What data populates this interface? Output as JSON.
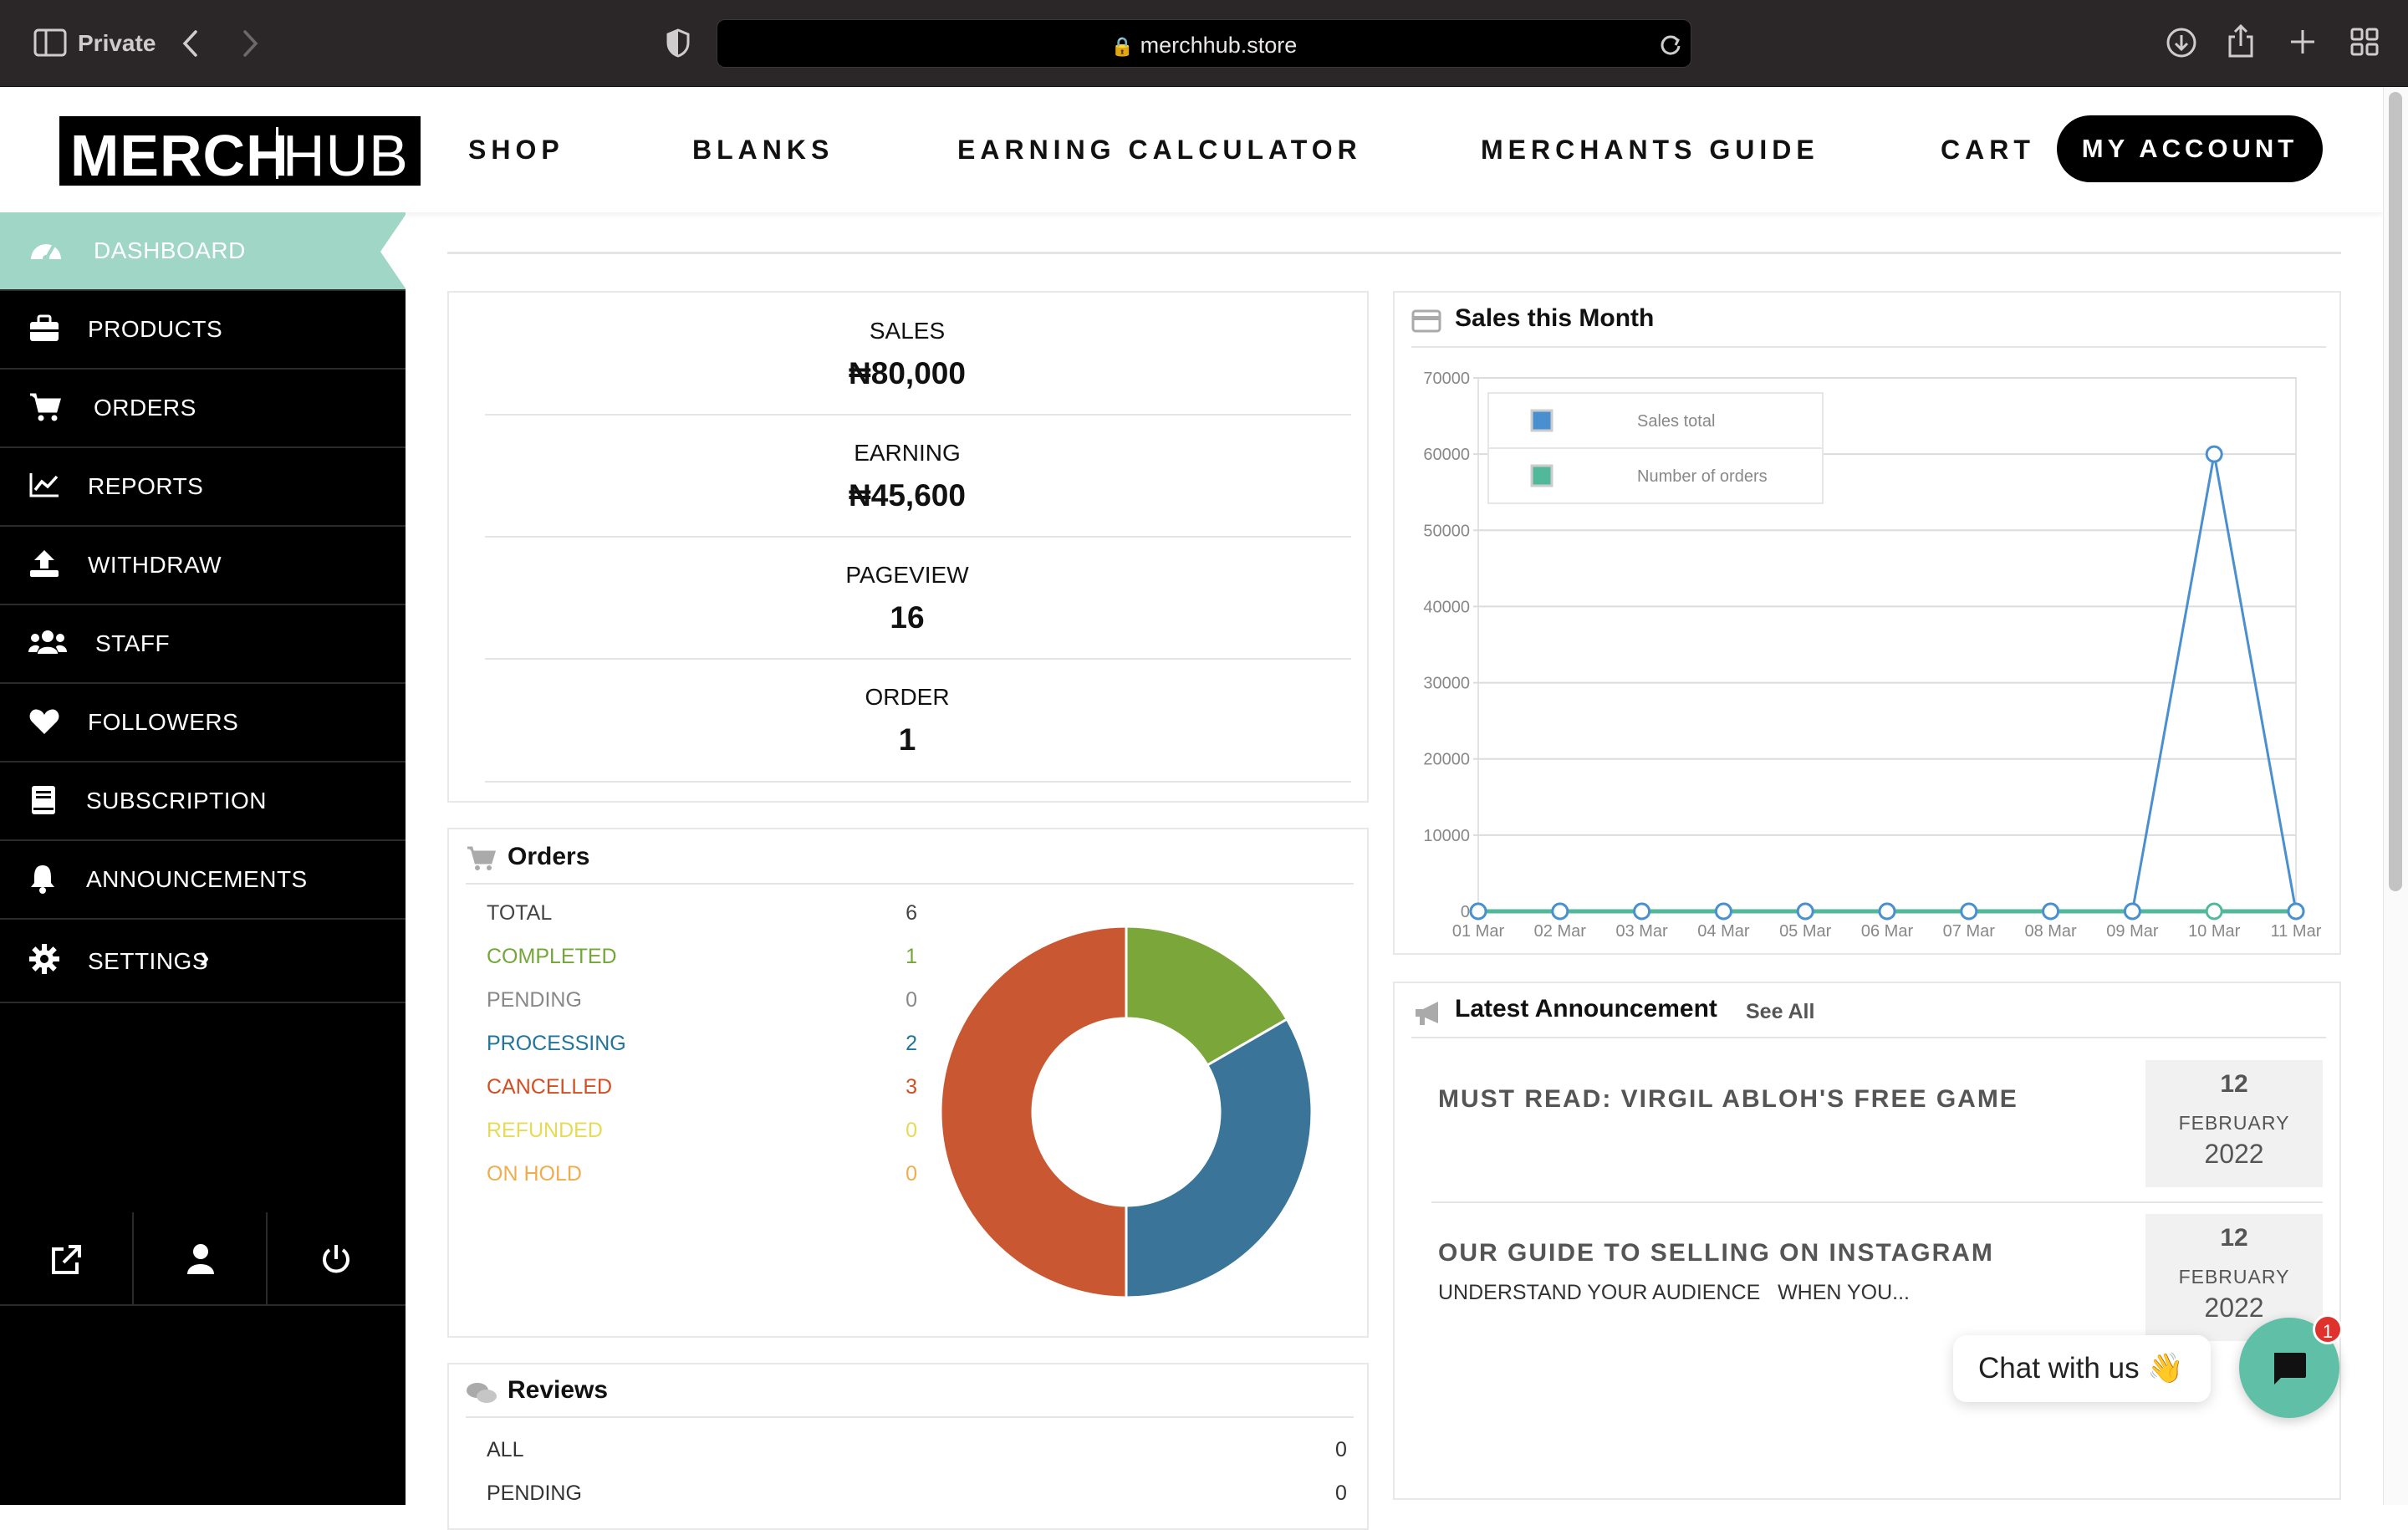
{
  "browser": {
    "mode_label": "Private",
    "url": "merchhub.store"
  },
  "site": {
    "logo": {
      "left": "MERCH",
      "right": "HUB"
    },
    "nav": [
      "SHOP",
      "BLANKS",
      "EARNING CALCULATOR",
      "MERCHANTS GUIDE",
      "CART"
    ],
    "account_label": "MY ACCOUNT"
  },
  "sidebar": {
    "items": [
      {
        "label": "DASHBOARD",
        "icon": "dashboard-icon",
        "active": true
      },
      {
        "label": "PRODUCTS",
        "icon": "briefcase-icon"
      },
      {
        "label": "ORDERS",
        "icon": "cart-icon"
      },
      {
        "label": "REPORTS",
        "icon": "chart-line-icon"
      },
      {
        "label": "WITHDRAW",
        "icon": "upload-icon"
      },
      {
        "label": "STAFF",
        "icon": "users-icon"
      },
      {
        "label": "FOLLOWERS",
        "icon": "heart-icon"
      },
      {
        "label": "SUBSCRIPTION",
        "icon": "book-icon"
      },
      {
        "label": "ANNOUNCEMENTS",
        "icon": "bell-icon"
      },
      {
        "label": "SETTINGS",
        "icon": "gear-icon"
      }
    ],
    "settings_chevron": "›"
  },
  "stats": [
    {
      "label": "SALES",
      "value": "₦80,000"
    },
    {
      "label": "EARNING",
      "value": "₦45,600"
    },
    {
      "label": "PAGEVIEW",
      "value": "16"
    },
    {
      "label": "ORDER",
      "value": "1"
    }
  ],
  "orders": {
    "title": "Orders",
    "rows": [
      {
        "label": "TOTAL",
        "value": "6",
        "color": "#444444"
      },
      {
        "label": "COMPLETED",
        "value": "1",
        "color": "#73a839"
      },
      {
        "label": "PENDING",
        "value": "0",
        "color": "#888888"
      },
      {
        "label": "PROCESSING",
        "value": "2",
        "color": "#21759b"
      },
      {
        "label": "CANCELLED",
        "value": "3",
        "color": "#d54e21"
      },
      {
        "label": "REFUNDED",
        "value": "0",
        "color": "#e6db55"
      },
      {
        "label": "ON HOLD",
        "value": "0",
        "color": "#f0ad4e"
      }
    ],
    "donut": {
      "slices": [
        {
          "name": "COMPLETED",
          "value": 1,
          "color": "#7ba63a"
        },
        {
          "name": "PROCESSING",
          "value": 2,
          "color": "#3a7499"
        },
        {
          "name": "CANCELLED",
          "value": 3,
          "color": "#c95732"
        }
      ]
    }
  },
  "reviews": {
    "title": "Reviews",
    "rows": [
      {
        "label": "ALL",
        "value": "0"
      },
      {
        "label": "PENDING",
        "value": "0"
      }
    ]
  },
  "sales_chart": {
    "title": "Sales this Month"
  },
  "chart_data": {
    "type": "line",
    "x": [
      "01 Mar",
      "02 Mar",
      "03 Mar",
      "04 Mar",
      "05 Mar",
      "06 Mar",
      "07 Mar",
      "08 Mar",
      "09 Mar",
      "10 Mar",
      "11 Mar"
    ],
    "series": [
      {
        "name": "Sales total",
        "values": [
          0,
          0,
          0,
          0,
          0,
          0,
          0,
          0,
          0,
          60000,
          0
        ],
        "color": "#4a90d0"
      },
      {
        "name": "Number of orders",
        "values": [
          0,
          0,
          0,
          0,
          0,
          0,
          0,
          0,
          0,
          1,
          0
        ],
        "color": "#52b89a"
      }
    ],
    "yticks": [
      0,
      10000,
      20000,
      30000,
      40000,
      50000,
      60000,
      70000
    ],
    "ylim": [
      0,
      70000
    ],
    "grid": true,
    "legend": "top-left"
  },
  "announcements": {
    "title": "Latest Announcement",
    "see_all": "See All",
    "items": [
      {
        "title": "MUST READ: VIRGIL ABLOH'S FREE GAME",
        "excerpt": "",
        "day": "12",
        "month": "FEBRUARY",
        "year": "2022"
      },
      {
        "title": "OUR GUIDE TO SELLING ON INSTAGRAM",
        "excerpt": "UNDERSTAND YOUR AUDIENCE   WHEN YOU...",
        "day": "12",
        "month": "FEBRUARY",
        "year": "2022"
      }
    ]
  },
  "chat": {
    "label": "Chat with us 👋",
    "badge": "1"
  }
}
